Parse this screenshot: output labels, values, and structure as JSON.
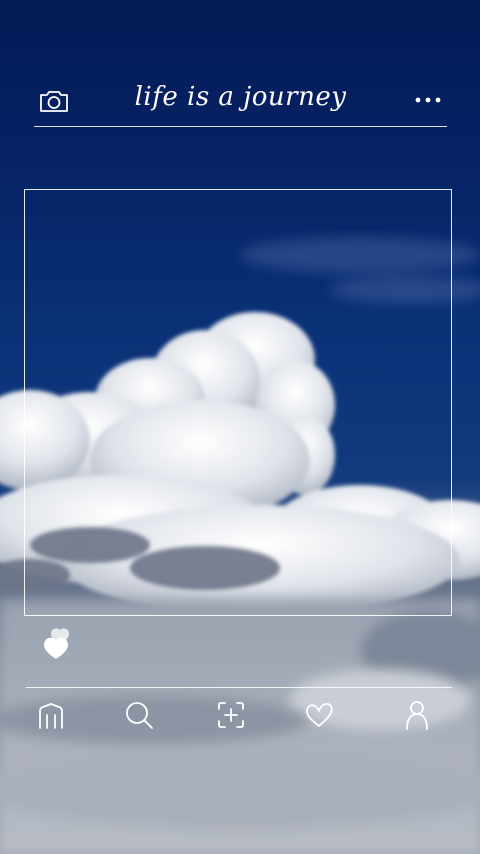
{
  "header": {
    "title": "life is a journey",
    "left_icon": "camera-icon",
    "right_icon": "more-horizontal-icon"
  },
  "post": {
    "image_description_icon": "sky-clouds-photo",
    "like_icon": "double-heart-icon"
  },
  "bottom_nav": {
    "items": [
      {
        "icon": "home-icon"
      },
      {
        "icon": "search-icon"
      },
      {
        "icon": "add-post-icon"
      },
      {
        "icon": "heart-icon"
      },
      {
        "icon": "profile-icon"
      }
    ]
  },
  "colors": {
    "sky_top": "#041a55",
    "sky_mid": "#0b3278",
    "cloud": "#e9ecf1",
    "line": "#ffffff"
  }
}
